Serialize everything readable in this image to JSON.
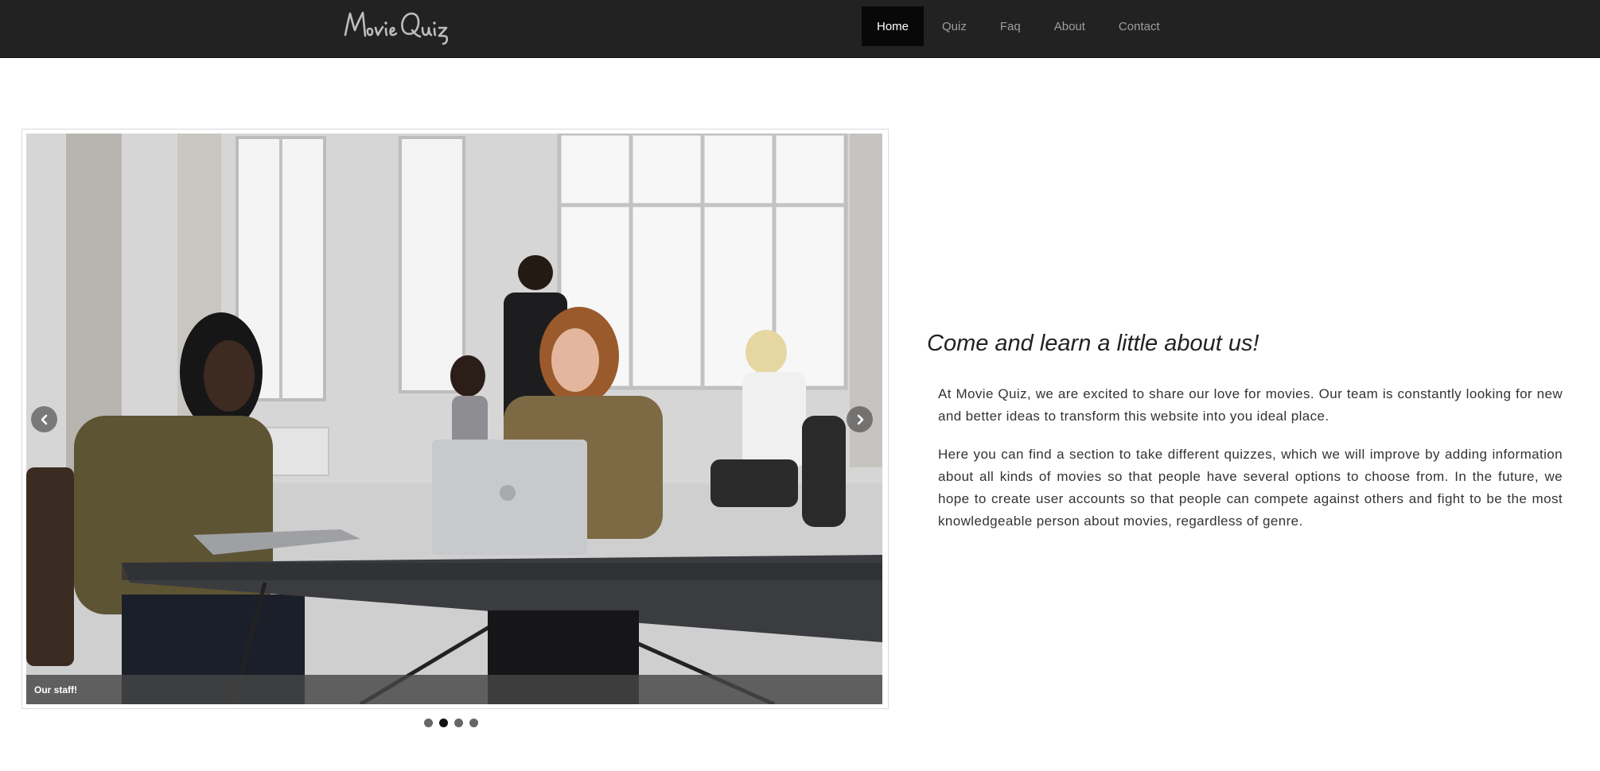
{
  "header": {
    "brand": "Movie Quiz",
    "nav": [
      {
        "label": "Home",
        "active": true
      },
      {
        "label": "Quiz",
        "active": false
      },
      {
        "label": "Faq",
        "active": false
      },
      {
        "label": "About",
        "active": false
      },
      {
        "label": "Contact",
        "active": false
      }
    ],
    "bg_color": "#222222"
  },
  "carousel": {
    "caption": "Our staff!",
    "prev_icon": "chevron-left-icon",
    "next_icon": "chevron-right-icon",
    "slide_count": 4,
    "active_index": 1
  },
  "about": {
    "title": "Come and learn a little about us!",
    "paragraphs": [
      "At Movie Quiz, we are excited to share our love for movies. Our team is constantly looking for new and better ideas to transform this website into you ideal place.",
      "Here you can find a section to take different quizzes, which we will improve by adding information about all kinds of movies so that people have several options to choose from. In the future, we hope to create user accounts so that people can compete against others and fight to be the most knowledgeable person about movies, regardless of genre."
    ]
  }
}
